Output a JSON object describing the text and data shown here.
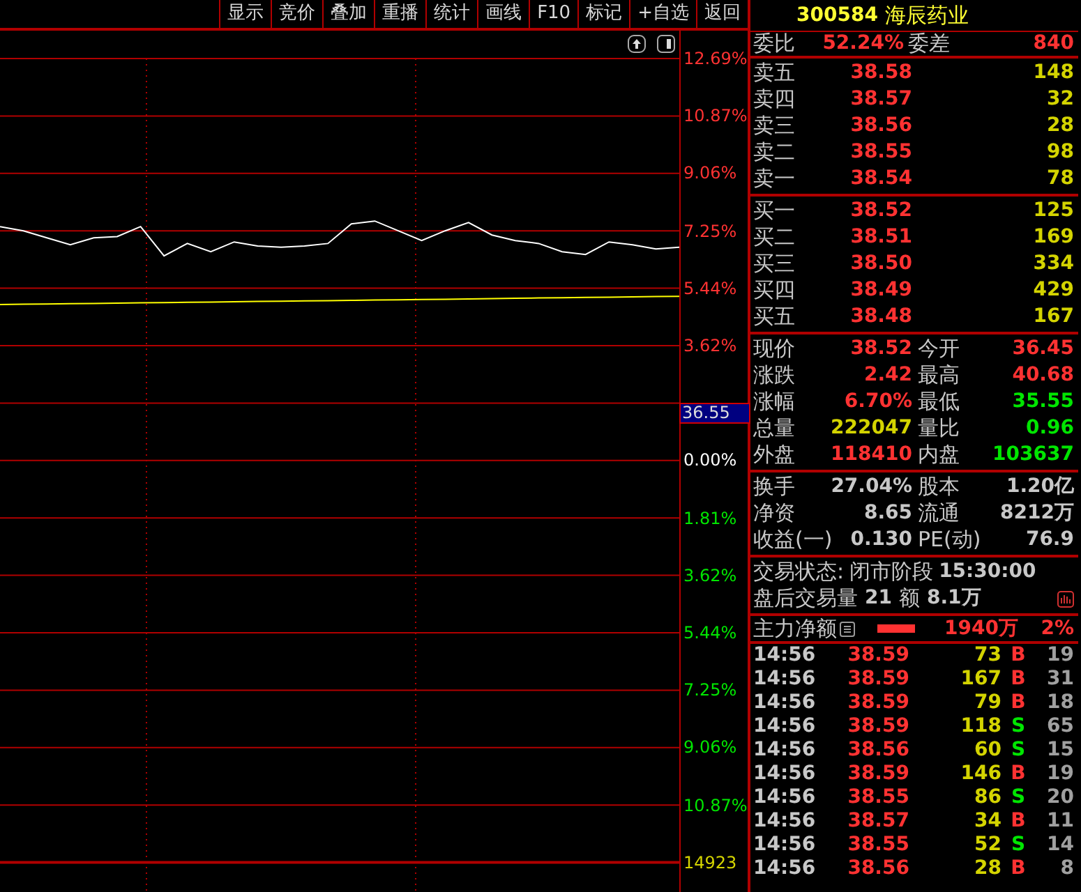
{
  "toolbar": {
    "buttons": [
      "显示",
      "竞价",
      "叠加",
      "重播",
      "统计",
      "画线",
      "F10",
      "标记",
      "+自选",
      "返回"
    ]
  },
  "chart": {
    "price_tag": "36.55",
    "volume_label": "14923",
    "axis_labels": [
      {
        "text": "12.69%",
        "kind": "up"
      },
      {
        "text": "10.87%",
        "kind": "up"
      },
      {
        "text": "9.06%",
        "kind": "up"
      },
      {
        "text": "7.25%",
        "kind": "up"
      },
      {
        "text": "5.44%",
        "kind": "up"
      },
      {
        "text": "3.62%",
        "kind": "up"
      },
      {
        "text": "0.00%",
        "kind": "flat"
      },
      {
        "text": "1.81%",
        "kind": "down"
      },
      {
        "text": "3.62%",
        "kind": "down"
      },
      {
        "text": "5.44%",
        "kind": "down"
      },
      {
        "text": "7.25%",
        "kind": "down"
      },
      {
        "text": "9.06%",
        "kind": "down"
      },
      {
        "text": "10.87%",
        "kind": "down"
      }
    ]
  },
  "quote": {
    "code": "300584",
    "name": "海辰药业",
    "ratio": {
      "label": "委比",
      "value": "52.24%",
      "label2": "委差",
      "value2": "840"
    },
    "asks": [
      {
        "label": "卖五",
        "price": "38.58",
        "volume": "148"
      },
      {
        "label": "卖四",
        "price": "38.57",
        "volume": "32"
      },
      {
        "label": "卖三",
        "price": "38.56",
        "volume": "28"
      },
      {
        "label": "卖二",
        "price": "38.55",
        "volume": "98"
      },
      {
        "label": "卖一",
        "price": "38.54",
        "volume": "78"
      }
    ],
    "bids": [
      {
        "label": "买一",
        "price": "38.52",
        "volume": "125"
      },
      {
        "label": "买二",
        "price": "38.51",
        "volume": "169"
      },
      {
        "label": "买三",
        "price": "38.50",
        "volume": "334"
      },
      {
        "label": "买四",
        "price": "38.49",
        "volume": "429"
      },
      {
        "label": "买五",
        "price": "38.48",
        "volume": "167"
      }
    ],
    "stats": [
      {
        "label": "现价",
        "value": "38.52",
        "kind": "up"
      },
      {
        "label": "今开",
        "value": "36.45",
        "kind": "up"
      },
      {
        "label": "涨跌",
        "value": "2.42",
        "kind": "up"
      },
      {
        "label": "最高",
        "value": "40.68",
        "kind": "up"
      },
      {
        "label": "涨幅",
        "value": "6.70%",
        "kind": "up"
      },
      {
        "label": "最低",
        "value": "35.55",
        "kind": "down"
      },
      {
        "label": "总量",
        "value": "222047",
        "kind": "volume"
      },
      {
        "label": "量比",
        "value": "0.96",
        "kind": "down"
      },
      {
        "label": "外盘",
        "value": "118410",
        "kind": "up"
      },
      {
        "label": "内盘",
        "value": "103637",
        "kind": "down"
      }
    ],
    "fundamentals": [
      {
        "label": "换手",
        "value": "27.04%",
        "kind": "neutral"
      },
      {
        "label": "股本",
        "value": "1.20亿",
        "kind": "neutral"
      },
      {
        "label": "净资",
        "value": "8.65",
        "kind": "neutral"
      },
      {
        "label": "流通",
        "value": "8212万",
        "kind": "neutral"
      },
      {
        "label": "收益(一)",
        "value": "0.130",
        "kind": "neutral"
      },
      {
        "label": "PE(动)",
        "value": "76.9",
        "kind": "neutral"
      }
    ],
    "status": {
      "label": "交易状态:",
      "phase": "闭市阶段",
      "time": "15:30:00"
    },
    "after_hours": {
      "label": "盘后交易量",
      "volume": "21",
      "amount_label": "额",
      "amount": "8.1万"
    },
    "main_flow": {
      "label": "主力净额",
      "value": "1940万",
      "percent": "2%"
    },
    "trades": [
      {
        "time": "14:56",
        "price": "38.59",
        "volume": "73",
        "side": "B",
        "kind": "buy",
        "count": "19"
      },
      {
        "time": "14:56",
        "price": "38.59",
        "volume": "167",
        "side": "B",
        "kind": "buy",
        "count": "31"
      },
      {
        "time": "14:56",
        "price": "38.59",
        "volume": "79",
        "side": "B",
        "kind": "buy",
        "count": "18"
      },
      {
        "time": "14:56",
        "price": "38.59",
        "volume": "118",
        "side": "S",
        "kind": "sell",
        "count": "65"
      },
      {
        "time": "14:56",
        "price": "38.56",
        "volume": "60",
        "side": "S",
        "kind": "sell",
        "count": "15"
      },
      {
        "time": "14:56",
        "price": "38.59",
        "volume": "146",
        "side": "B",
        "kind": "buy",
        "count": "19"
      },
      {
        "time": "14:56",
        "price": "38.55",
        "volume": "86",
        "side": "S",
        "kind": "sell",
        "count": "20"
      },
      {
        "time": "14:56",
        "price": "38.57",
        "volume": "34",
        "side": "B",
        "kind": "buy",
        "count": "11"
      },
      {
        "time": "14:56",
        "price": "38.55",
        "volume": "52",
        "side": "S",
        "kind": "sell",
        "count": "14"
      },
      {
        "time": "14:56",
        "price": "38.56",
        "volume": "28",
        "side": "B",
        "kind": "buy",
        "count": "8"
      }
    ]
  }
}
